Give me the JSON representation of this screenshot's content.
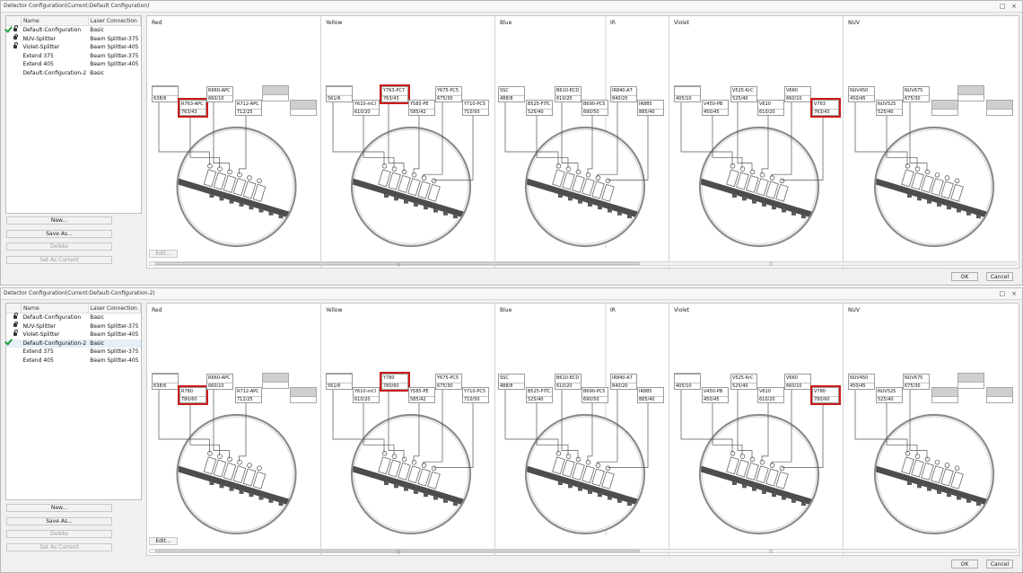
{
  "columns": [
    "Name",
    "Laser Connection"
  ],
  "left_buttons": {
    "new": "New...",
    "save_as": "Save As...",
    "delete": "Delete",
    "set_current": "Set As Current"
  },
  "edit_label": "Edit...",
  "ok_label": "OK",
  "cancel_label": "Cancel",
  "window_icons": {
    "restore": "restore-icon",
    "close": "close-icon"
  },
  "colors": {
    "highlight": "#cc1b1b",
    "check": "#1e9e3a",
    "selected_row": "#e6eef8"
  },
  "windows": [
    {
      "title": "Detector Configuration(Current:Default Configuration)",
      "configs": [
        {
          "name": "Default-Configuration",
          "laser": "Basic",
          "locked": true,
          "current": true
        },
        {
          "name": "NUV-Splitter",
          "laser": "Beam Splitter-375",
          "locked": true,
          "current": false
        },
        {
          "name": "Violet-Splitter",
          "laser": "Beam Splitter-405",
          "locked": true,
          "current": false
        },
        {
          "name": "Extend 375",
          "laser": "Beam Splitter-375",
          "locked": false,
          "current": false
        },
        {
          "name": "Extend 405",
          "laser": "Beam Splitter-405",
          "locked": false,
          "current": false
        },
        {
          "name": "Default-Configuration-2",
          "laser": "Basic",
          "locked": false,
          "current": false
        }
      ],
      "lasers": {
        "red": {
          "label": "Red",
          "det": [
            {
              "f": "",
              "b": "638/6"
            },
            {
              "f": "R763-APC",
              "b": "763/43"
            },
            {
              "f": "R660-APC",
              "b": "660/10"
            },
            {
              "f": "R712-APC",
              "b": "712/25"
            }
          ]
        },
        "yellow": {
          "label": "Yellow",
          "det": [
            {
              "f": "",
              "b": "561/6"
            },
            {
              "f": "Y610-mCl",
              "b": "610/20"
            },
            {
              "f": "Y763-PC7",
              "b": "763/43"
            },
            {
              "f": "Y585-PE",
              "b": "585/42"
            },
            {
              "f": "Y675-PC5",
              "b": "675/30"
            },
            {
              "f": "Y710-PC5",
              "b": "710/50"
            }
          ]
        },
        "blue": {
          "label": "Blue",
          "det": [
            {
              "f": "SSC",
              "b": "488/8"
            },
            {
              "f": "B525-FITC",
              "b": "525/40"
            },
            {
              "f": "B610-ECD",
              "b": "610/20"
            },
            {
              "f": "B690-PC5",
              "b": "690/50"
            }
          ]
        },
        "ir": {
          "label": "IR",
          "det": [
            {
              "f": "IR840-A7",
              "b": "840/20"
            },
            {
              "f": "IR885",
              "b": "885/40"
            }
          ]
        },
        "violet": {
          "label": "Violet",
          "det": [
            {
              "f": "",
              "b": "405/10"
            },
            {
              "f": "V450-PB",
              "b": "450/45"
            },
            {
              "f": "V525-KrC",
              "b": "525/40"
            },
            {
              "f": "V610",
              "b": "610/20"
            },
            {
              "f": "V660",
              "b": "660/10"
            },
            {
              "f": "V763",
              "b": "763/43"
            }
          ]
        },
        "nuv": {
          "label": "NUV",
          "det": [
            {
              "f": "NUV450",
              "b": "450/45"
            },
            {
              "f": "NUV525",
              "b": "525/40"
            },
            {
              "f": "NUV675",
              "b": "675/30"
            }
          ]
        }
      }
    },
    {
      "title": "Detector Configuration(Current:Default-Configuration-2)",
      "configs": [
        {
          "name": "Default-Configuration",
          "laser": "Basic",
          "locked": true,
          "current": false
        },
        {
          "name": "NUV-Splitter",
          "laser": "Beam Splitter-375",
          "locked": true,
          "current": false
        },
        {
          "name": "Violet-Splitter",
          "laser": "Beam Splitter-405",
          "locked": true,
          "current": false
        },
        {
          "name": "Default-Configuration-2",
          "laser": "Basic",
          "locked": false,
          "current": true
        },
        {
          "name": "Extend 375",
          "laser": "Beam Splitter-375",
          "locked": false,
          "current": false
        },
        {
          "name": "Extend 405",
          "laser": "Beam Splitter-405",
          "locked": false,
          "current": false
        }
      ],
      "lasers": {
        "red": {
          "label": "Red",
          "det": [
            {
              "f": "",
              "b": "638/6"
            },
            {
              "f": "R780",
              "b": "780/60"
            },
            {
              "f": "R660-APC",
              "b": "660/10"
            },
            {
              "f": "R712-APC",
              "b": "712/25"
            }
          ]
        },
        "yellow": {
          "label": "Yellow",
          "det": [
            {
              "f": "",
              "b": "561/6"
            },
            {
              "f": "Y610-mCl",
              "b": "610/20"
            },
            {
              "f": "Y780",
              "b": "780/60"
            },
            {
              "f": "Y585-PE",
              "b": "585/42"
            },
            {
              "f": "Y675-PC5",
              "b": "675/30"
            },
            {
              "f": "Y710-PC5",
              "b": "710/50"
            }
          ]
        },
        "blue": {
          "label": "Blue",
          "det": [
            {
              "f": "SSC",
              "b": "488/8"
            },
            {
              "f": "B525-FITC",
              "b": "525/40"
            },
            {
              "f": "B610-ECD",
              "b": "610/20"
            },
            {
              "f": "B690-PC5",
              "b": "690/50"
            }
          ]
        },
        "ir": {
          "label": "IR",
          "det": [
            {
              "f": "IR840-A7",
              "b": "840/20"
            },
            {
              "f": "IR885",
              "b": "885/40"
            }
          ]
        },
        "violet": {
          "label": "Violet",
          "det": [
            {
              "f": "",
              "b": "405/10"
            },
            {
              "f": "V450-PB",
              "b": "450/45"
            },
            {
              "f": "V525-KrC",
              "b": "525/40"
            },
            {
              "f": "V610",
              "b": "610/20"
            },
            {
              "f": "V660",
              "b": "660/10"
            },
            {
              "f": "V780",
              "b": "780/60"
            }
          ]
        },
        "nuv": {
          "label": "NUV",
          "det": [
            {
              "f": "NUV450",
              "b": "450/45"
            },
            {
              "f": "NUV525",
              "b": "525/40"
            },
            {
              "f": "NUV675",
              "b": "675/30"
            }
          ]
        }
      }
    }
  ]
}
